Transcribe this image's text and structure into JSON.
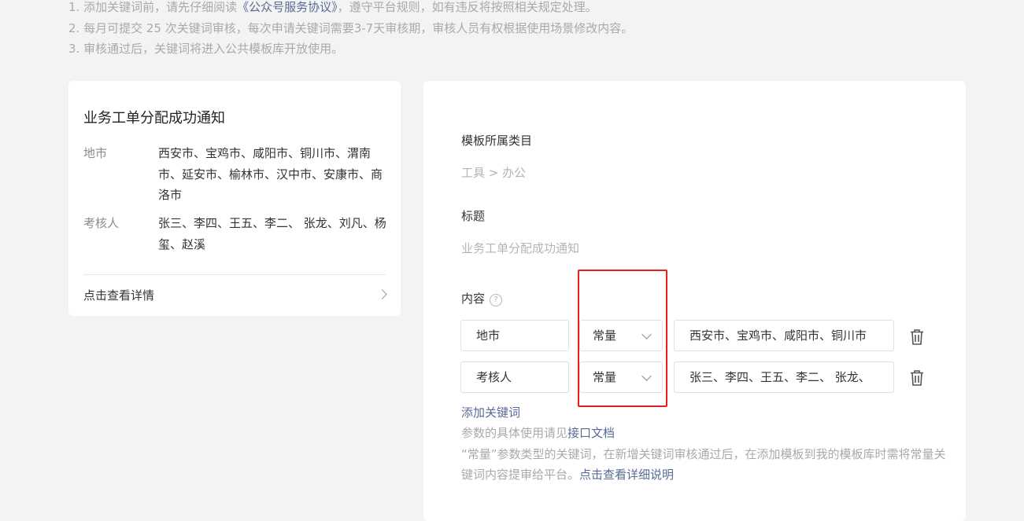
{
  "notes": {
    "line1_before": "1. 添加关键词前，请先仔细阅读",
    "line1_link": "《公众号服务协议》",
    "line1_after": "，遵守平台规则，如有违反将按照相关规定处理。",
    "line2": "2. 每月可提交 25 次关键词审核，每次申请关键词需要3-7天审核期，审核人员有权根据使用场景修改内容。",
    "line3": "3. 审核通过后，关键词将进入公共模板库开放使用。"
  },
  "preview": {
    "title": "业务工单分配成功通知",
    "fields": [
      {
        "key": "地市",
        "value": "西安市、宝鸡市、咸阳市、铜川市、渭南市、延安市、榆林市、汉中市、安康市、商洛市"
      },
      {
        "key": "考核人",
        "value": "张三、李四、王五、李二、 张龙、刘凡、杨玺、赵溪"
      }
    ],
    "detail_label": "点击查看详情"
  },
  "form": {
    "category_label": "模板所属类目",
    "category_value": "工具 > 办公",
    "title_label": "标题",
    "title_value": "业务工单分配成功通知",
    "content_label": "内容",
    "help_glyph": "?",
    "rows": [
      {
        "name": "地市",
        "type": "常量",
        "value": "西安市、宝鸡市、咸阳市、铜川市"
      },
      {
        "name": "考核人",
        "type": "常量",
        "value": "张三、李四、王五、李二、 张龙、"
      }
    ],
    "add_keyword": "添加关键词",
    "doc_prefix": "参数的具体使用请见",
    "doc_link": "接口文档",
    "note_text": "“常量”参数类型的关键词，在新增关键词审核通过后，在添加模板到我的模板库时需将常量关键词内容提审给平台。",
    "note_link": "点击查看详细说明"
  },
  "colors": {
    "link": "#576b95",
    "highlight": "#e3201d",
    "muted": "#a9a9a9"
  },
  "icons": {
    "help": "question-circle-icon",
    "delete": "trash-icon",
    "dropdown": "chevron-down-icon",
    "detail": "chevron-right-icon"
  }
}
